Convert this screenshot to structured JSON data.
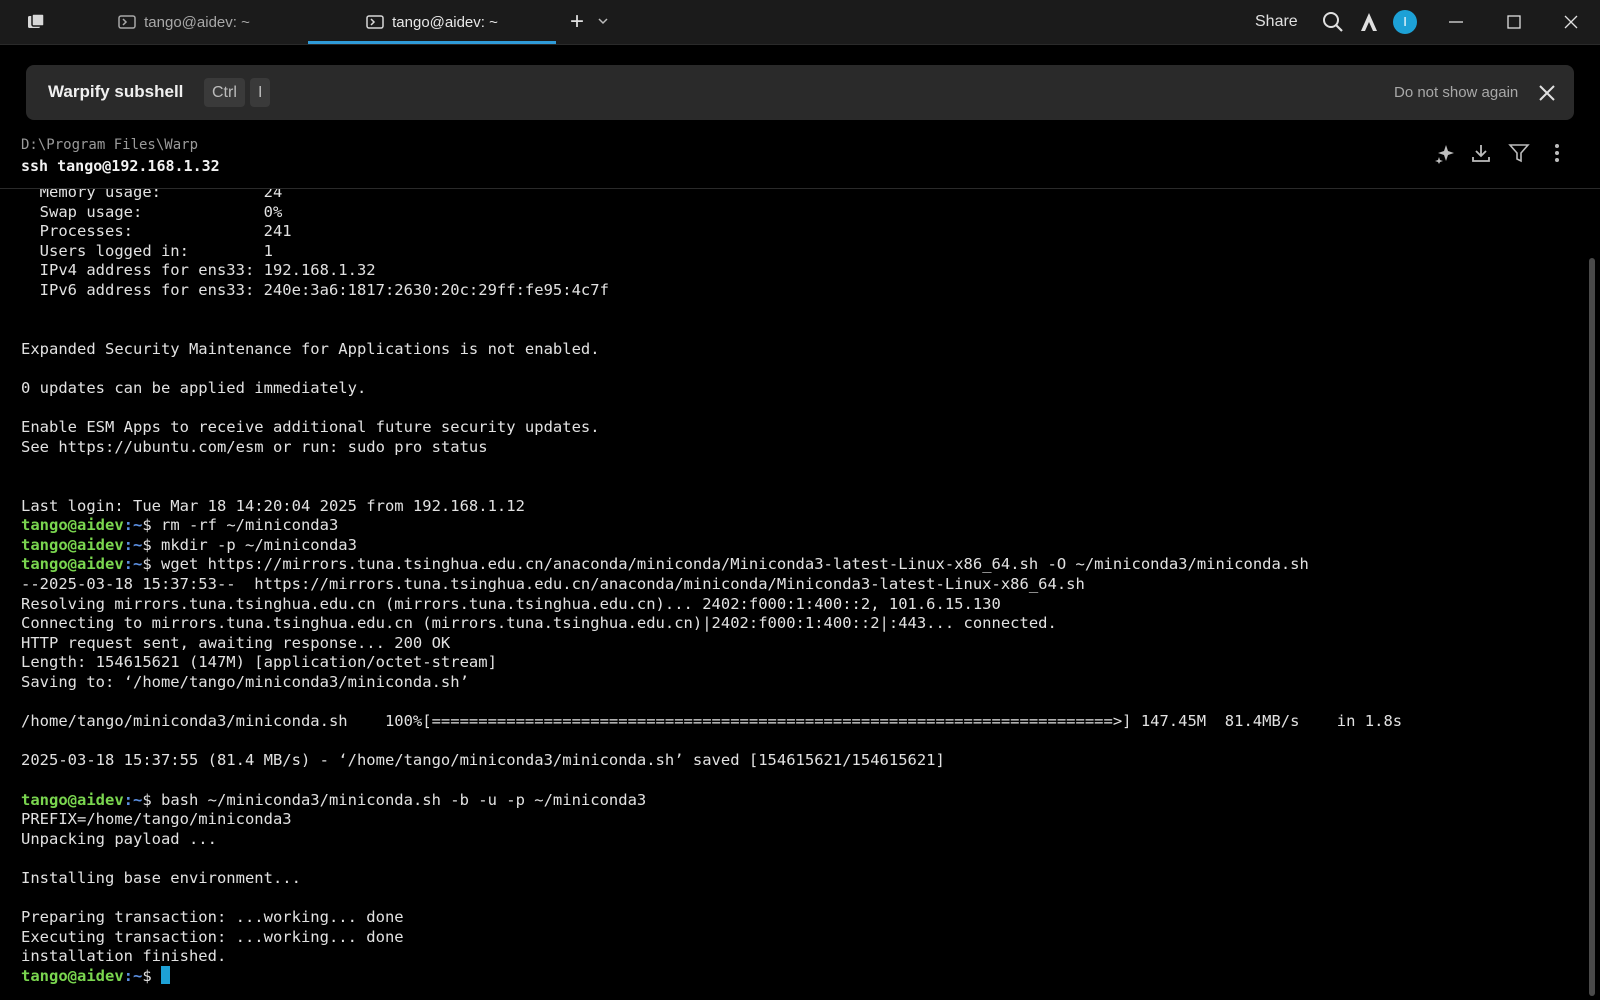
{
  "tabs": [
    {
      "label": "tango@aidev: ~"
    },
    {
      "label": "tango@aidev: ~"
    }
  ],
  "titlebar": {
    "share_label": "Share",
    "avatar_initial": "I"
  },
  "banner": {
    "title": "Warpify subshell",
    "key1": "Ctrl",
    "key2": "I",
    "dismiss_label": "Do not show again"
  },
  "block": {
    "cwd": "D:\\Program Files\\Warp",
    "command": "ssh tango@192.168.1.32"
  },
  "terminal": {
    "prompt_user": "tango@aidev",
    "prompt_path": ":~",
    "prompt_suffix": "$ ",
    "lines": [
      {
        "text": "  Memory usage:           24"
      },
      {
        "text": "  Swap usage:             0%"
      },
      {
        "text": "  Processes:              241"
      },
      {
        "text": "  Users logged in:        1"
      },
      {
        "text": "  IPv4 address for ens33: 192.168.1.32"
      },
      {
        "text": "  IPv6 address for ens33: 240e:3a6:1817:2630:20c:29ff:fe95:4c7f"
      },
      {
        "text": ""
      },
      {
        "text": ""
      },
      {
        "text": "Expanded Security Maintenance for Applications is not enabled."
      },
      {
        "text": ""
      },
      {
        "text": "0 updates can be applied immediately."
      },
      {
        "text": ""
      },
      {
        "text": "Enable ESM Apps to receive additional future security updates."
      },
      {
        "text": "See https://ubuntu.com/esm or run: sudo pro status"
      },
      {
        "text": ""
      },
      {
        "text": ""
      },
      {
        "text": "Last login: Tue Mar 18 14:20:04 2025 from 192.168.1.12"
      },
      {
        "prompt": true,
        "text": "rm -rf ~/miniconda3"
      },
      {
        "prompt": true,
        "text": "mkdir -p ~/miniconda3"
      },
      {
        "prompt": true,
        "text": "wget https://mirrors.tuna.tsinghua.edu.cn/anaconda/miniconda/Miniconda3-latest-Linux-x86_64.sh -O ~/miniconda3/miniconda.sh"
      },
      {
        "text": "--2025-03-18 15:37:53--  https://mirrors.tuna.tsinghua.edu.cn/anaconda/miniconda/Miniconda3-latest-Linux-x86_64.sh"
      },
      {
        "text": "Resolving mirrors.tuna.tsinghua.edu.cn (mirrors.tuna.tsinghua.edu.cn)... 2402:f000:1:400::2, 101.6.15.130"
      },
      {
        "text": "Connecting to mirrors.tuna.tsinghua.edu.cn (mirrors.tuna.tsinghua.edu.cn)|2402:f000:1:400::2|:443... connected."
      },
      {
        "text": "HTTP request sent, awaiting response... 200 OK"
      },
      {
        "text": "Length: 154615621 (147M) [application/octet-stream]"
      },
      {
        "text": "Saving to: ‘/home/tango/miniconda3/miniconda.sh’"
      },
      {
        "text": ""
      },
      {
        "text": "/home/tango/miniconda3/miniconda.sh    100%[=========================================================================>] 147.45M  81.4MB/s    in 1.8s"
      },
      {
        "text": ""
      },
      {
        "text": "2025-03-18 15:37:55 (81.4 MB/s) - ‘/home/tango/miniconda3/miniconda.sh’ saved [154615621/154615621]"
      },
      {
        "text": ""
      },
      {
        "prompt": true,
        "text": "bash ~/miniconda3/miniconda.sh -b -u -p ~/miniconda3"
      },
      {
        "text": "PREFIX=/home/tango/miniconda3"
      },
      {
        "text": "Unpacking payload ..."
      },
      {
        "text": ""
      },
      {
        "text": "Installing base environment..."
      },
      {
        "text": ""
      },
      {
        "text": "Preparing transaction: ...working... done"
      },
      {
        "text": "Executing transaction: ...working... done"
      },
      {
        "text": "installation finished."
      },
      {
        "prompt": true,
        "text": "",
        "cursor": true
      }
    ]
  }
}
